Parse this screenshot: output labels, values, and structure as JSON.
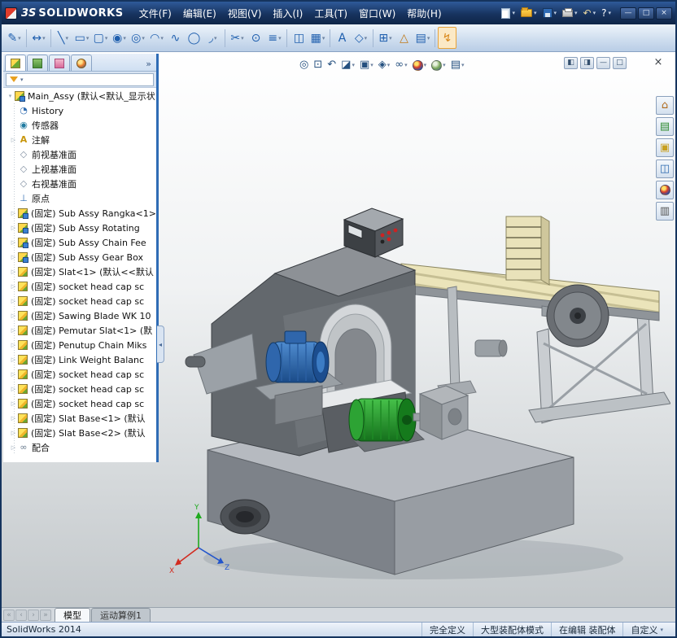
{
  "ui": {
    "caret": "▾",
    "expand": "▷",
    "root_arrow": "▾"
  },
  "titlebar": {
    "brand_prefix": "3S",
    "brand_name": "SOLIDWORKS",
    "menus": [
      {
        "name": "menu-file",
        "label": "文件(F)"
      },
      {
        "name": "menu-edit",
        "label": "编辑(E)"
      },
      {
        "name": "menu-view",
        "label": "视图(V)"
      },
      {
        "name": "menu-insert",
        "label": "插入(I)"
      },
      {
        "name": "menu-tools",
        "label": "工具(T)"
      },
      {
        "name": "menu-window",
        "label": "窗口(W)"
      },
      {
        "name": "menu-help",
        "label": "帮助(H)"
      }
    ],
    "tools": [
      {
        "name": "new-document-button",
        "kind": "doc",
        "caret": true
      },
      {
        "name": "open-document-button",
        "kind": "folder",
        "caret": true
      },
      {
        "name": "save-button",
        "kind": "save",
        "caret": true
      },
      {
        "name": "print-button",
        "kind": "print",
        "caret": true
      },
      {
        "name": "undo-button",
        "glyph": "↶",
        "color": "#e8d6a0",
        "caret": true
      },
      {
        "name": "help-button",
        "glyph": "?",
        "color": "#ffffff",
        "caret": true
      }
    ],
    "window_controls": [
      {
        "name": "minimize-button",
        "glyph": "—"
      },
      {
        "name": "maximize-button",
        "glyph": "□"
      },
      {
        "name": "close-button",
        "glyph": "×"
      }
    ]
  },
  "sketch_toolbar": {
    "items": [
      {
        "name": "sketch-button",
        "glyph": "✎",
        "caret": true
      },
      {
        "sep": true
      },
      {
        "name": "smart-dimension-button",
        "glyph": "↔",
        "caret": true
      },
      {
        "sep": true
      },
      {
        "name": "line-tool",
        "glyph": "╲",
        "caret": true
      },
      {
        "name": "rectangle-tool",
        "glyph": "▭",
        "caret": true
      },
      {
        "name": "slot-tool",
        "glyph": "▢",
        "caret": true
      },
      {
        "name": "circle-tool",
        "glyph": "◉",
        "caret": true
      },
      {
        "name": "perimeter-circle-tool",
        "glyph": "◎",
        "caret": true
      },
      {
        "name": "arc-tool",
        "glyph": "◠",
        "caret": true
      },
      {
        "name": "spline-tool",
        "glyph": "∿"
      },
      {
        "name": "ellipse-tool",
        "glyph": "◯"
      },
      {
        "name": "fillet-tool",
        "glyph": "◞",
        "caret": true
      },
      {
        "sep": true
      },
      {
        "name": "trim-entities-button",
        "glyph": "✂",
        "caret": true
      },
      {
        "name": "convert-entities-button",
        "glyph": "⊙"
      },
      {
        "name": "offset-entities-button",
        "glyph": "≡",
        "caret": true
      },
      {
        "sep": true
      },
      {
        "name": "mirror-entities-button",
        "glyph": "◫"
      },
      {
        "name": "linear-pattern-button",
        "glyph": "▦",
        "caret": true
      },
      {
        "sep": true
      },
      {
        "name": "sketch-text-button",
        "glyph": "A"
      },
      {
        "name": "reference-plane-button",
        "glyph": "◇",
        "caret": true
      },
      {
        "sep": true
      },
      {
        "name": "display-relations-button",
        "glyph": "⊞",
        "caret": true
      },
      {
        "name": "repair-sketch-button",
        "glyph": "△",
        "color": "#c07a18"
      },
      {
        "name": "quick-snaps-button",
        "glyph": "▤",
        "caret": true
      },
      {
        "sep": true
      },
      {
        "name": "instant2d-button",
        "glyph": "↯",
        "color": "#d8871a",
        "hl": true
      }
    ]
  },
  "panel": {
    "more_glyph": "»",
    "handle_glyph": "◂",
    "tabs": [
      {
        "name": "tab-featuremanager",
        "kind": "fm"
      },
      {
        "name": "tab-propertymanager",
        "kind": "pm"
      },
      {
        "name": "tab-configurationmanager",
        "kind": "cm"
      },
      {
        "name": "tab-displaymanager",
        "kind": "ball"
      }
    ]
  },
  "tree": {
    "root": "Main_Assy (默认<默认_显示状",
    "icon_glyphs": {
      "history": "◔",
      "sensor": "◉",
      "annotation": "A",
      "plane": "◇",
      "origin": "⊥",
      "mate": "∞"
    },
    "items": [
      {
        "kind": "history",
        "label": "History"
      },
      {
        "kind": "sensor",
        "label": "传感器"
      },
      {
        "kind": "annotation",
        "label": "注解",
        "arrow": true
      },
      {
        "kind": "plane",
        "label": "前视基准面"
      },
      {
        "kind": "plane",
        "label": "上视基准面"
      },
      {
        "kind": "plane",
        "label": "右视基准面"
      },
      {
        "kind": "origin",
        "label": "原点"
      },
      {
        "kind": "assembly",
        "label": "(固定) Sub Assy Rangka<1>",
        "arrow": true
      },
      {
        "kind": "assembly",
        "label": "(固定) Sub Assy Rotating",
        "arrow": true
      },
      {
        "kind": "assembly",
        "label": "(固定) Sub Assy Chain Fee",
        "arrow": true
      },
      {
        "kind": "assembly",
        "label": "(固定) Sub Assy Gear Box",
        "arrow": true
      },
      {
        "kind": "part",
        "label": "(固定) Slat<1> (默认<<默认",
        "arrow": true
      },
      {
        "kind": "part",
        "label": "(固定) socket head cap sc",
        "arrow": true
      },
      {
        "kind": "part",
        "label": "(固定) socket head cap sc",
        "arrow": true
      },
      {
        "kind": "part",
        "label": "(固定) Sawing Blade WK 10",
        "arrow": true
      },
      {
        "kind": "part",
        "label": "(固定) Pemutar Slat<1> (默",
        "arrow": true
      },
      {
        "kind": "part",
        "label": "(固定) Penutup Chain Miks",
        "arrow": true
      },
      {
        "kind": "part",
        "label": "(固定) Link Weight Balanc",
        "arrow": true
      },
      {
        "kind": "part",
        "label": "(固定) socket head cap sc",
        "arrow": true
      },
      {
        "kind": "part",
        "label": "(固定) socket head cap sc",
        "arrow": true
      },
      {
        "kind": "part",
        "label": "(固定) socket head cap sc",
        "arrow": true
      },
      {
        "kind": "part",
        "label": "(固定) Slat Base<1> (默认",
        "arrow": true
      },
      {
        "kind": "part",
        "label": "(固定) Slat Base<2> (默认",
        "arrow": true
      },
      {
        "kind": "mate",
        "label": "配合",
        "arrow": true
      }
    ]
  },
  "viewport": {
    "headsup": [
      {
        "name": "zoom-to-fit-button",
        "glyph": "◎"
      },
      {
        "name": "zoom-to-area-button",
        "glyph": "⊡"
      },
      {
        "name": "previous-view-button",
        "glyph": "↶"
      },
      {
        "name": "section-view-button",
        "glyph": "◪",
        "caret": true
      },
      {
        "name": "view-orientation-button",
        "glyph": "▣",
        "caret": true
      },
      {
        "name": "display-style-button",
        "glyph": "◈",
        "caret": true
      },
      {
        "name": "hide-show-items-button",
        "glyph": "∞",
        "caret": true
      },
      {
        "name": "edit-appearance-button",
        "ball": "ball-rgb",
        "caret": true
      },
      {
        "name": "apply-scene-button",
        "ball": "ball-scene",
        "caret": true
      },
      {
        "name": "view-settings-button",
        "glyph": "▤",
        "caret": true
      }
    ],
    "window_buttons": [
      {
        "name": "doc-pane-left-button",
        "glyph": "◧"
      },
      {
        "name": "doc-pane-right-button",
        "glyph": "◨"
      },
      {
        "name": "doc-minimize-button",
        "glyph": "—"
      },
      {
        "name": "doc-restore-button",
        "glyph": "□"
      }
    ],
    "close_button": {
      "glyph": "×"
    },
    "triad": {
      "x": "X",
      "y": "Y",
      "z": "Z"
    }
  },
  "taskpane": {
    "items": [
      {
        "name": "solidworks-resources-tab",
        "glyph": "⌂",
        "color": "#b06a1a"
      },
      {
        "name": "design-library-tab",
        "glyph": "▤",
        "color": "#2e8b2e"
      },
      {
        "name": "file-explorer-tab",
        "glyph": "▣",
        "color": "#c8a020"
      },
      {
        "name": "view-palette-tab",
        "glyph": "◫",
        "color": "#2e6bb0"
      },
      {
        "name": "appearances-scenes-tab",
        "ball": "ball-rgb"
      },
      {
        "name": "custom-properties-tab",
        "glyph": "▥",
        "color": "#555555"
      }
    ]
  },
  "tabbar": {
    "nav": [
      {
        "name": "tab-scroll-first",
        "glyph": "«"
      },
      {
        "name": "tab-scroll-prev",
        "glyph": "‹"
      },
      {
        "name": "tab-scroll-next",
        "glyph": "›"
      },
      {
        "name": "tab-scroll-last",
        "glyph": "»"
      }
    ],
    "tabs": [
      {
        "name": "tab-model",
        "label": "模型",
        "active": true
      },
      {
        "name": "tab-motion-study-1",
        "label": "运动算例1",
        "active": false
      }
    ]
  },
  "status": {
    "app": "SolidWorks 2014",
    "items": [
      {
        "name": "status-fully-defined",
        "label": "完全定义",
        "interactable": false
      },
      {
        "name": "status-large-assembly-mode",
        "label": "大型装配体模式",
        "interactable": false
      },
      {
        "name": "status-editing-assembly",
        "label": "在编辑 装配体",
        "interactable": false
      },
      {
        "name": "status-custom",
        "label": "自定义",
        "caret": true,
        "interactable": true
      }
    ]
  }
}
